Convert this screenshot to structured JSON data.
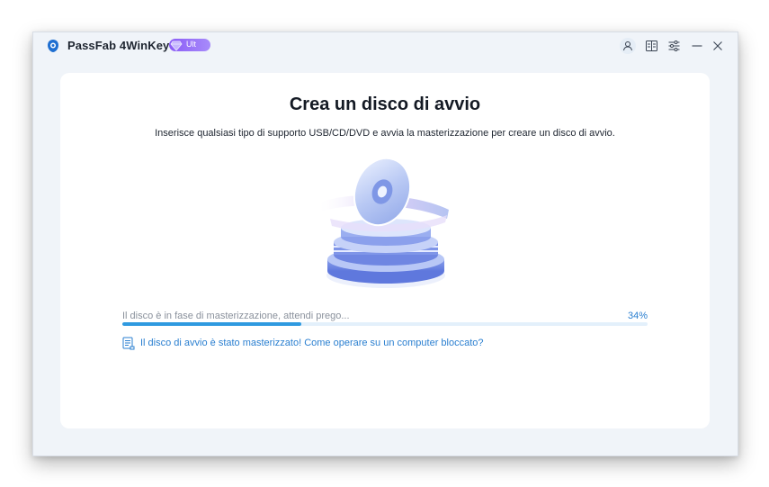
{
  "app": {
    "title": "PassFab 4WinKey",
    "edition_badge": "Ult",
    "accent_color": "#2f9ae0",
    "badge_color": "#8b5cf6"
  },
  "titlebar": {
    "icons": [
      "user-icon",
      "feedback-icon",
      "settings-icon",
      "minimize-icon",
      "close-icon"
    ]
  },
  "main": {
    "heading": "Crea un disco di avvio",
    "subtitle": "Inserisce qualsiasi tipo di supporto USB/CD/DVD e avvia la masterizzazione per creare un disco di avvio.",
    "progress": {
      "label": "Il disco è in fase di masterizzazione, attendi prego...",
      "percent_text": "34%",
      "value": 0.34
    },
    "help_link": {
      "icon": "document-icon",
      "text": "Il disco di avvio è stato masterizzato! Come operare su un computer bloccato?"
    }
  }
}
